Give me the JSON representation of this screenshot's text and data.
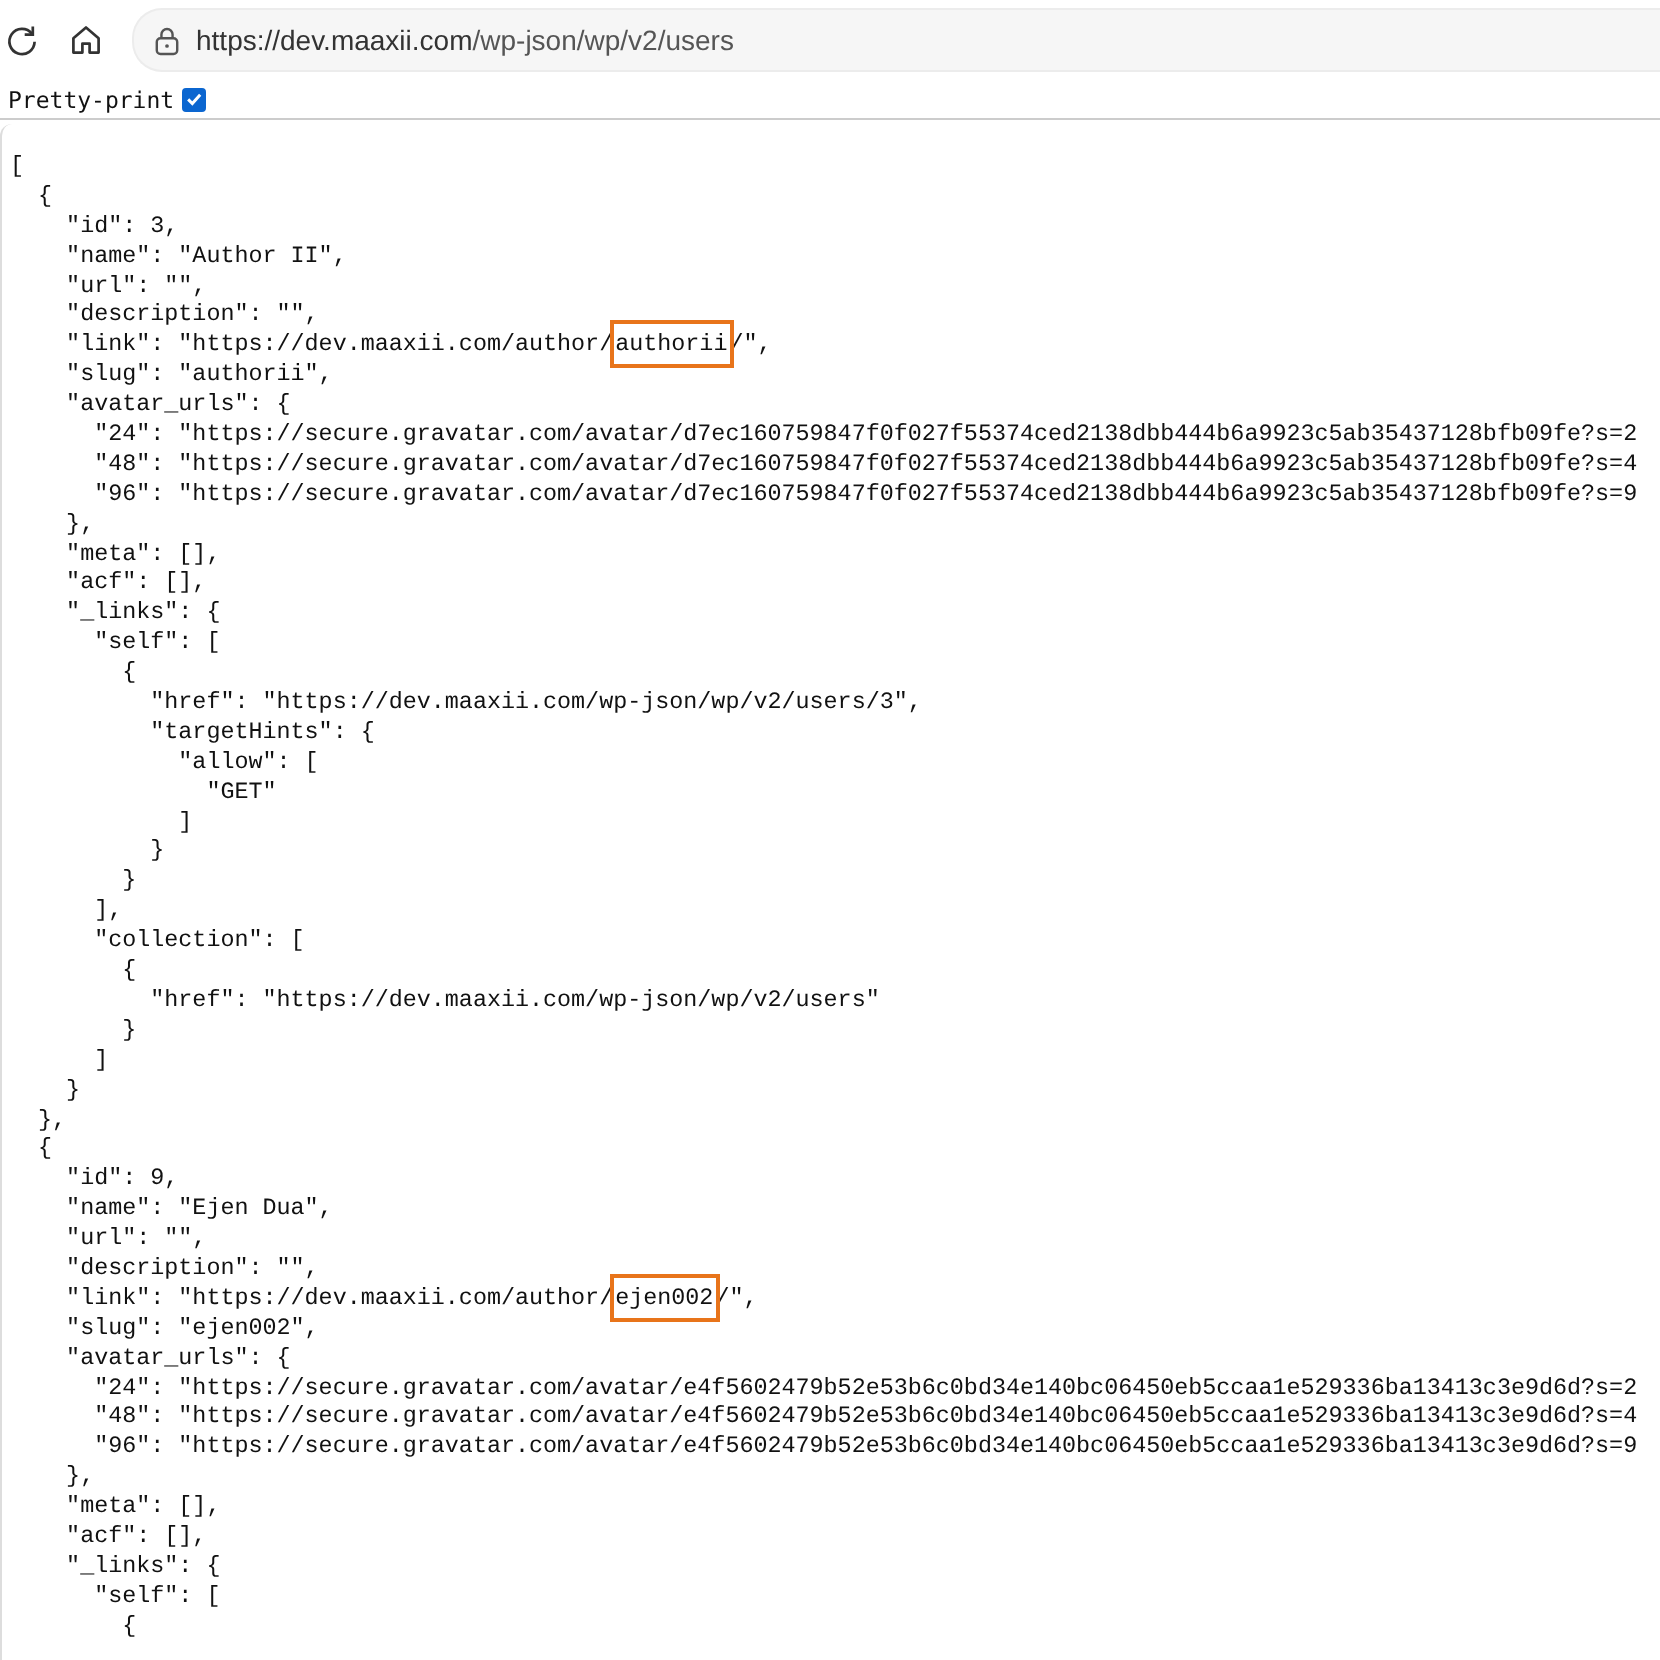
{
  "browser": {
    "url_host": "https://dev.maaxii.com",
    "url_path": "/wp-json/wp/v2/users"
  },
  "pretty_print": {
    "label": "Pretty-print",
    "checked": true
  },
  "lines": [
    {
      "text": "["
    },
    {
      "text": "  {"
    },
    {
      "text": "    \"id\": 3,"
    },
    {
      "text": "    \"name\": \"Author II\","
    },
    {
      "text": "    \"url\": \"\","
    },
    {
      "text": "    \"description\": \"\","
    },
    {
      "text": "    \"link\": \"https://dev.maaxii.com/author/",
      "highlight": "authorii",
      "after": "/\","
    },
    {
      "text": "    \"slug\": \"authorii\","
    },
    {
      "text": "    \"avatar_urls\": {"
    },
    {
      "text": "      \"24\": \"https://secure.gravatar.com/avatar/d7ec160759847f0f027f55374ced2138dbb444b6a9923c5ab35437128bfb09fe?s=2"
    },
    {
      "text": "      \"48\": \"https://secure.gravatar.com/avatar/d7ec160759847f0f027f55374ced2138dbb444b6a9923c5ab35437128bfb09fe?s=4"
    },
    {
      "text": "      \"96\": \"https://secure.gravatar.com/avatar/d7ec160759847f0f027f55374ced2138dbb444b6a9923c5ab35437128bfb09fe?s=9"
    },
    {
      "text": "    },"
    },
    {
      "text": "    \"meta\": [],"
    },
    {
      "text": "    \"acf\": [],"
    },
    {
      "text": "    \"_links\": {"
    },
    {
      "text": "      \"self\": ["
    },
    {
      "text": "        {"
    },
    {
      "text": "          \"href\": \"https://dev.maaxii.com/wp-json/wp/v2/users/3\","
    },
    {
      "text": "          \"targetHints\": {"
    },
    {
      "text": "            \"allow\": ["
    },
    {
      "text": "              \"GET\""
    },
    {
      "text": "            ]"
    },
    {
      "text": "          }"
    },
    {
      "text": "        }"
    },
    {
      "text": "      ],"
    },
    {
      "text": "      \"collection\": ["
    },
    {
      "text": "        {"
    },
    {
      "text": "          \"href\": \"https://dev.maaxii.com/wp-json/wp/v2/users\""
    },
    {
      "text": "        }"
    },
    {
      "text": "      ]"
    },
    {
      "text": "    }"
    },
    {
      "text": "  },"
    },
    {
      "text": "  {"
    },
    {
      "text": "    \"id\": 9,"
    },
    {
      "text": "    \"name\": \"Ejen Dua\","
    },
    {
      "text": "    \"url\": \"\","
    },
    {
      "text": "    \"description\": \"\","
    },
    {
      "text": "    \"link\": \"https://dev.maaxii.com/author/",
      "highlight": "ejen002",
      "after": "/\","
    },
    {
      "text": "    \"slug\": \"ejen002\","
    },
    {
      "text": "    \"avatar_urls\": {"
    },
    {
      "text": "      \"24\": \"https://secure.gravatar.com/avatar/e4f5602479b52e53b6c0bd34e140bc06450eb5ccaa1e529336ba13413c3e9d6d?s=2"
    },
    {
      "text": "      \"48\": \"https://secure.gravatar.com/avatar/e4f5602479b52e53b6c0bd34e140bc06450eb5ccaa1e529336ba13413c3e9d6d?s=4"
    },
    {
      "text": "      \"96\": \"https://secure.gravatar.com/avatar/e4f5602479b52e53b6c0bd34e140bc06450eb5ccaa1e529336ba13413c3e9d6d?s=9"
    },
    {
      "text": "    },"
    },
    {
      "text": "    \"meta\": [],"
    },
    {
      "text": "    \"acf\": [],"
    },
    {
      "text": "    \"_links\": {"
    },
    {
      "text": "      \"self\": ["
    },
    {
      "text": "        {"
    }
  ]
}
